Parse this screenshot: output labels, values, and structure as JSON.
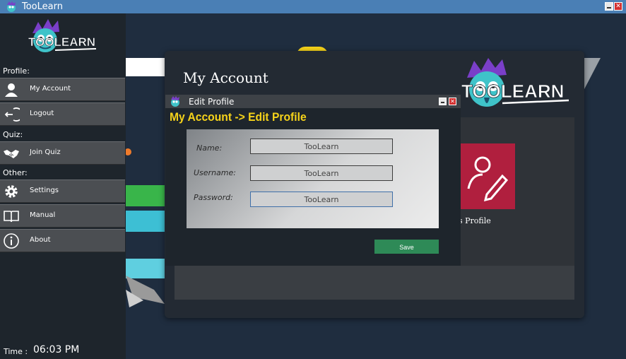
{
  "window": {
    "title": "TooLearn"
  },
  "sidebar": {
    "sections": {
      "profile": "Profile:",
      "quiz": "Quiz:",
      "other": "Other:"
    },
    "items": [
      {
        "label": "My Account",
        "icon": "user-icon"
      },
      {
        "label": "Logout",
        "icon": "logout-icon"
      },
      {
        "label": "Join Quiz",
        "icon": "handshake-icon"
      },
      {
        "label": "Settings",
        "icon": "gear-icon"
      },
      {
        "label": "Manual",
        "icon": "book-icon"
      },
      {
        "label": "About",
        "icon": "info-icon"
      }
    ],
    "time_label": "Time :",
    "time_value": "06:03 PM"
  },
  "account_panel": {
    "title": "My Account",
    "card_caption": "s Profile"
  },
  "dialog": {
    "title": "Edit Profile",
    "breadcrumb": "My Account -> Edit Profile",
    "fields": {
      "name": {
        "label": "Name:",
        "value": "TooLearn"
      },
      "username": {
        "label": "Username:",
        "value": "TooLearn"
      },
      "password": {
        "label": "Password:",
        "value": "TooLearn"
      }
    },
    "save_label": "Save"
  },
  "colors": {
    "accent_yellow": "#f5d21a",
    "save_green": "#2e8a57",
    "card_red": "#b01f3e",
    "titlebar_blue": "#4a7fb5"
  }
}
